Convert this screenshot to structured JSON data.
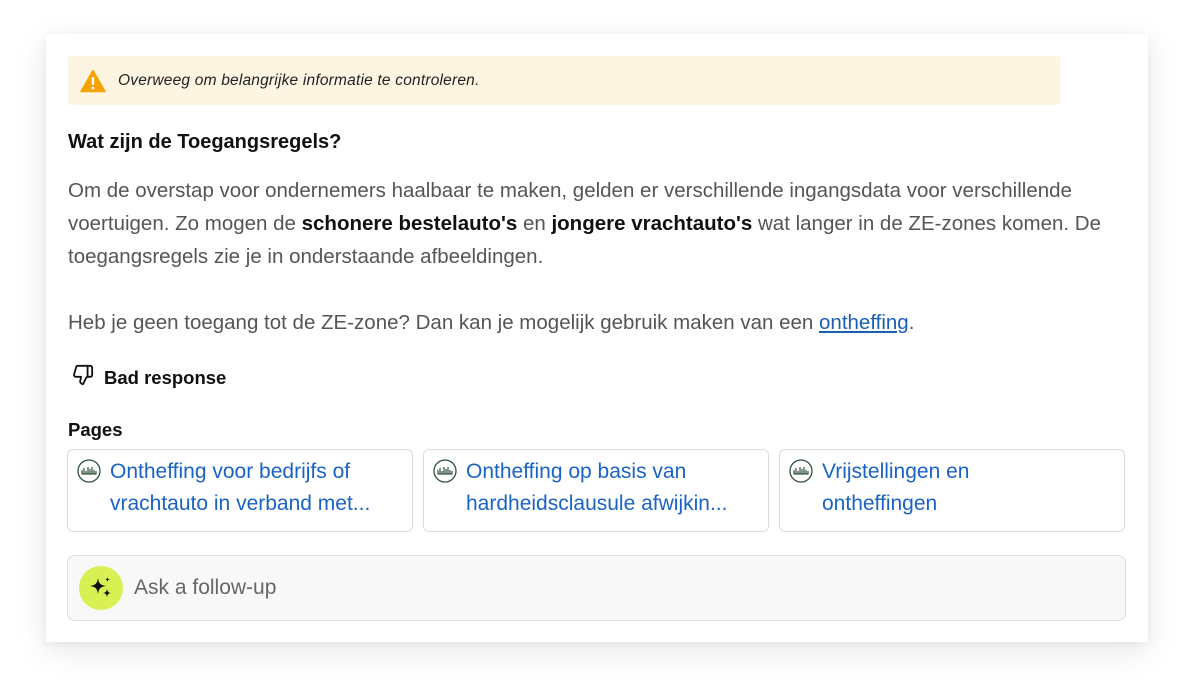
{
  "warning": {
    "icon": "warning-triangle-icon",
    "text": "Overweeg om belangrijke informatie te controleren."
  },
  "answer": {
    "heading": "Wat zijn de Toegangsregels?",
    "p1_part1": "Om de overstap voor ondernemers haalbaar te maken, gelden er verschillende ingangsdata voor verschillende voertuigen. Zo mogen de ",
    "p1_bold1": "schonere bestelauto's",
    "p1_part2": " en ",
    "p1_bold2": "jongere vrachtauto's",
    "p1_part3": " wat langer in de ZE-zones komen. De toegangsregels zie je in onderstaande afbeeldingen.",
    "p2_text": "Heb je geen toegang tot de ZE-zone? Dan kan je mogelijk gebruik maken van een ",
    "p2_link": "ontheffing",
    "p2_end": "."
  },
  "feedback": {
    "icon": "thumbs-down-icon",
    "label": "Bad response"
  },
  "pages": {
    "label": "Pages",
    "items": [
      {
        "line1": "Ontheffing voor bedrijfs of",
        "line2": "vrachtauto in verband met..."
      },
      {
        "line1": "Ontheffing op basis van",
        "line2": "hardheidsclausule afwijkin..."
      },
      {
        "line1": "Vrijstellingen en",
        "line2": "ontheffingen"
      }
    ]
  },
  "followup": {
    "icon": "sparkle-icon",
    "placeholder": "Ask a follow-up"
  },
  "colors": {
    "warning_bg": "#fef4e2",
    "warning_icon": "#f5a300",
    "link": "#1a63c6",
    "accent": "#d9f052"
  }
}
